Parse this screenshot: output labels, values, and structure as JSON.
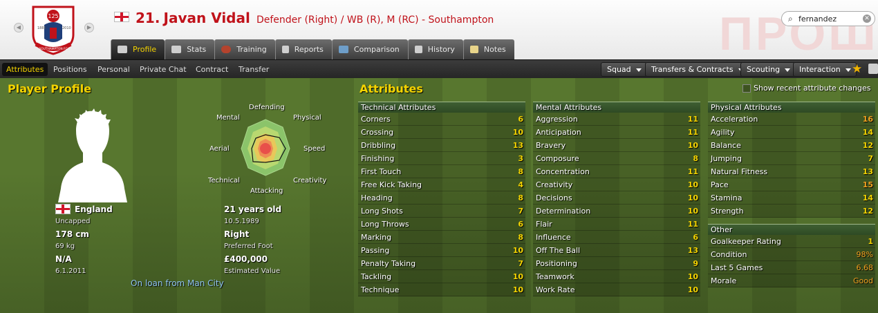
{
  "header": {
    "shirt_number": "21.",
    "player_name": "Javan Vidal",
    "positions": "Defender (Right) / WB (R), M (RC) - Southampton",
    "search_value": "fernandez",
    "watermark": "ПРОШ",
    "crest": {
      "number": "125",
      "year_left": "1885",
      "year_right": "2010",
      "name": "SOUTHAMPTON FC"
    }
  },
  "tabs": [
    {
      "label": "Profile",
      "icon": "profile-icon",
      "active": true
    },
    {
      "label": "Stats",
      "icon": "stats-icon"
    },
    {
      "label": "Training",
      "icon": "training-icon"
    },
    {
      "label": "Reports",
      "icon": "reports-icon"
    },
    {
      "label": "Comparison",
      "icon": "comparison-icon"
    },
    {
      "label": "History",
      "icon": "history-icon"
    },
    {
      "label": "Notes",
      "icon": "notes-icon"
    }
  ],
  "subnav": [
    "Attributes",
    "Positions",
    "Personal",
    "Private Chat",
    "Contract",
    "Transfer"
  ],
  "menus": [
    "Squad",
    "Transfers & Contracts",
    "Scouting",
    "Interaction"
  ],
  "profile": {
    "heading": "Player Profile",
    "nationality": "England",
    "caps": "Uncapped",
    "height": "178 cm",
    "weight": "69 kg",
    "status": "N/A",
    "status_date": "6.1.2011",
    "age": "21 years old",
    "dob": "10.5.1989",
    "foot": "Right",
    "foot_label": "Preferred Foot",
    "value": "£400,000",
    "value_label": "Estimated Value",
    "loan": "On loan from Man City",
    "radar_labels": [
      "Defending",
      "Physical",
      "Speed",
      "Creativity",
      "Attacking",
      "Technical",
      "Aerial",
      "Mental"
    ]
  },
  "attributes": {
    "heading": "Attributes",
    "recent_label": "Show recent attribute changes",
    "technical": {
      "title": "Technical Attributes",
      "rows": [
        {
          "name": "Corners",
          "value": "6"
        },
        {
          "name": "Crossing",
          "value": "10"
        },
        {
          "name": "Dribbling",
          "value": "13"
        },
        {
          "name": "Finishing",
          "value": "3"
        },
        {
          "name": "First Touch",
          "value": "8"
        },
        {
          "name": "Free Kick Taking",
          "value": "4"
        },
        {
          "name": "Heading",
          "value": "8"
        },
        {
          "name": "Long Shots",
          "value": "7"
        },
        {
          "name": "Long Throws",
          "value": "6"
        },
        {
          "name": "Marking",
          "value": "8"
        },
        {
          "name": "Passing",
          "value": "10"
        },
        {
          "name": "Penalty Taking",
          "value": "7"
        },
        {
          "name": "Tackling",
          "value": "10"
        },
        {
          "name": "Technique",
          "value": "10"
        }
      ]
    },
    "mental": {
      "title": "Mental Attributes",
      "rows": [
        {
          "name": "Aggression",
          "value": "11"
        },
        {
          "name": "Anticipation",
          "value": "11"
        },
        {
          "name": "Bravery",
          "value": "10"
        },
        {
          "name": "Composure",
          "value": "8"
        },
        {
          "name": "Concentration",
          "value": "11"
        },
        {
          "name": "Creativity",
          "value": "10"
        },
        {
          "name": "Decisions",
          "value": "10"
        },
        {
          "name": "Determination",
          "value": "10"
        },
        {
          "name": "Flair",
          "value": "11"
        },
        {
          "name": "Influence",
          "value": "6"
        },
        {
          "name": "Off The Ball",
          "value": "13"
        },
        {
          "name": "Positioning",
          "value": "9"
        },
        {
          "name": "Teamwork",
          "value": "10"
        },
        {
          "name": "Work Rate",
          "value": "10"
        }
      ]
    },
    "physical": {
      "title": "Physical Attributes",
      "rows": [
        {
          "name": "Acceleration",
          "value": "16"
        },
        {
          "name": "Agility",
          "value": "14"
        },
        {
          "name": "Balance",
          "value": "12"
        },
        {
          "name": "Jumping",
          "value": "7"
        },
        {
          "name": "Natural Fitness",
          "value": "13"
        },
        {
          "name": "Pace",
          "value": "15"
        },
        {
          "name": "Stamina",
          "value": "14"
        },
        {
          "name": "Strength",
          "value": "12"
        }
      ]
    },
    "other": {
      "title": "Other",
      "rows": [
        {
          "name": "Goalkeeper Rating",
          "value": "1"
        },
        {
          "name": "Condition",
          "value": "98%"
        },
        {
          "name": "Last 5 Games",
          "value": "6.68"
        },
        {
          "name": "Morale",
          "value": "Good"
        }
      ]
    }
  },
  "colors": {
    "accent": "#f5d400",
    "title_red": "#c0121a",
    "value_orange": "#f0a020",
    "loan_blue": "#8fc3ef"
  }
}
